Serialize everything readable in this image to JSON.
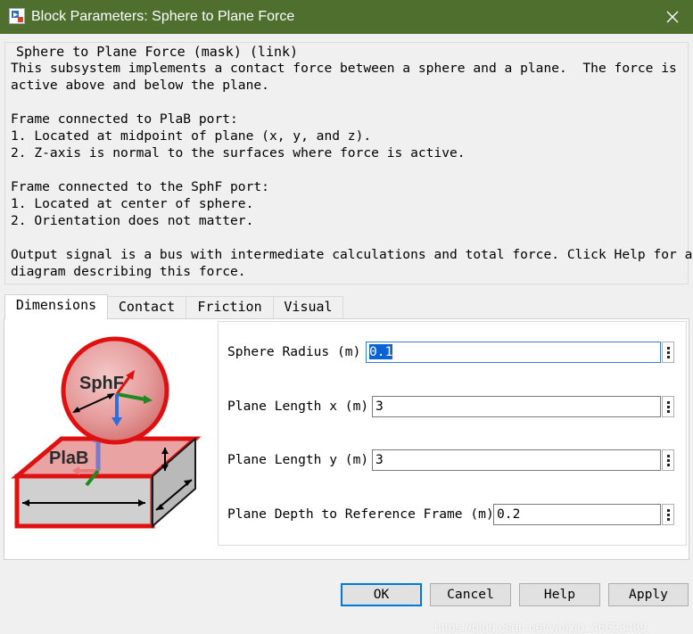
{
  "window": {
    "title": "Block Parameters: Sphere to Plane Force",
    "close_glyph": "✕",
    "titlebar_color": "#4f6f2f"
  },
  "group": {
    "legend": "Sphere to Plane Force (mask) (link)",
    "description_lines": [
      "This subsystem implements a contact force between a sphere and a plane.  The force is",
      "active above and below the plane.",
      "",
      "Frame connected to PlaB port:",
      "1. Located at midpoint of plane (x, y, and z).",
      "2. Z-axis is normal to the surfaces where force is active.",
      "",
      "Frame connected to the SphF port:",
      "1. Located at center of sphere.",
      "2. Orientation does not matter.",
      "",
      "Output signal is a bus with intermediate calculations and total force. Click Help for a",
      "diagram describing this force."
    ]
  },
  "tabs": [
    {
      "label": "Dimensions",
      "active": true
    },
    {
      "label": "Contact",
      "active": false
    },
    {
      "label": "Friction",
      "active": false
    },
    {
      "label": "Visual",
      "active": false
    }
  ],
  "diagram": {
    "sphere_label": "SphF",
    "plane_label": "PlaB"
  },
  "params": [
    {
      "label": "Sphere Radius (m)",
      "value": "0.1"
    },
    {
      "label": "Plane Length x (m)",
      "value": "3"
    },
    {
      "label": "Plane Length y (m)",
      "value": "3"
    },
    {
      "label": "Plane Depth to Reference Frame (m)",
      "value": "0.2"
    }
  ],
  "buttons": {
    "ok": "OK",
    "cancel": "Cancel",
    "help": "Help",
    "apply": "Apply"
  },
  "watermark": "https://blog.csdn.net/weixin_46623489",
  "icons": [
    "simulink-block-icon",
    "close-icon",
    "kebab-menu-icon"
  ],
  "colors": {
    "selection": "#0a64d6",
    "focus_border": "#3b79d6",
    "default_button_border": "#0078d7"
  }
}
